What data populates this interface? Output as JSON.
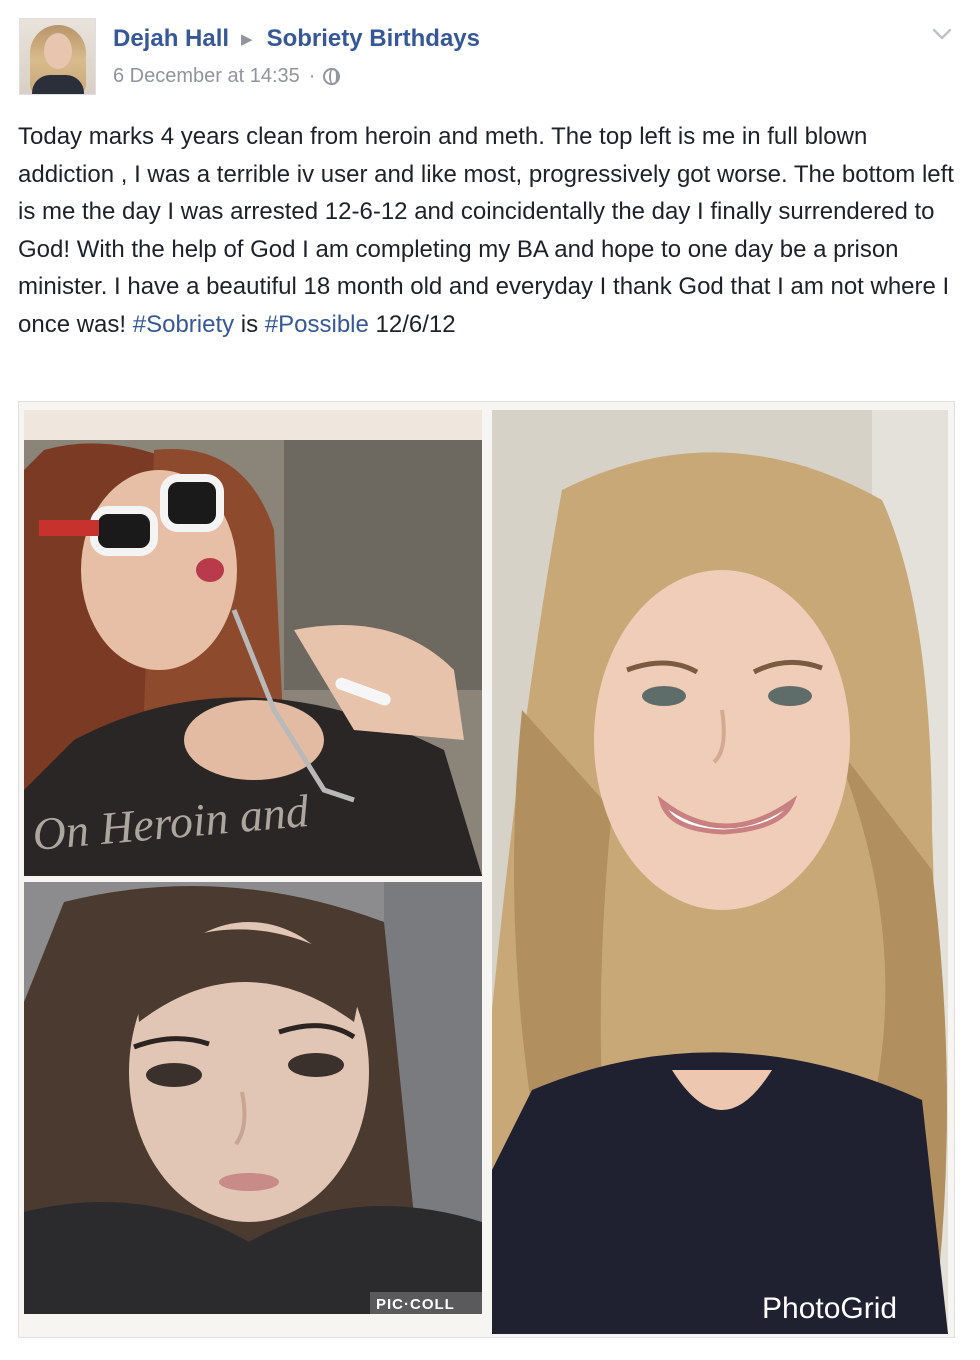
{
  "post": {
    "author": "Dejah Hall",
    "group": "Sobriety Birthdays",
    "timestamp": "6 December at 14:35",
    "separator": "·",
    "privacy_icon": "globe-icon",
    "options_icon": "chevron-down-icon",
    "text_parts": [
      "Today marks 4 years clean from heroin and meth. The top left is me in full blown addiction , I was a terrible iv user and like most, progressively got worse. The bottom left is me the day I was arrested 12-6-12 and coincidentally the day I finally surrendered to God! With the help of God I am completing my BA and hope to one day be a prison minister. I have a beautiful 18 month old and everyday I thank God that I am not where I once was! ",
      "#Sobriety",
      " is ",
      "#Possible",
      " 12/6/12"
    ]
  },
  "photos": {
    "top_left": {
      "watermark": "On Heroin and"
    },
    "bottom_left": {
      "watermark": "PIC·COLL"
    },
    "right": {
      "watermark": "PhotoGrid"
    }
  },
  "colors": {
    "link": "#365899",
    "meta": "#90949c",
    "text": "#1d2129"
  }
}
